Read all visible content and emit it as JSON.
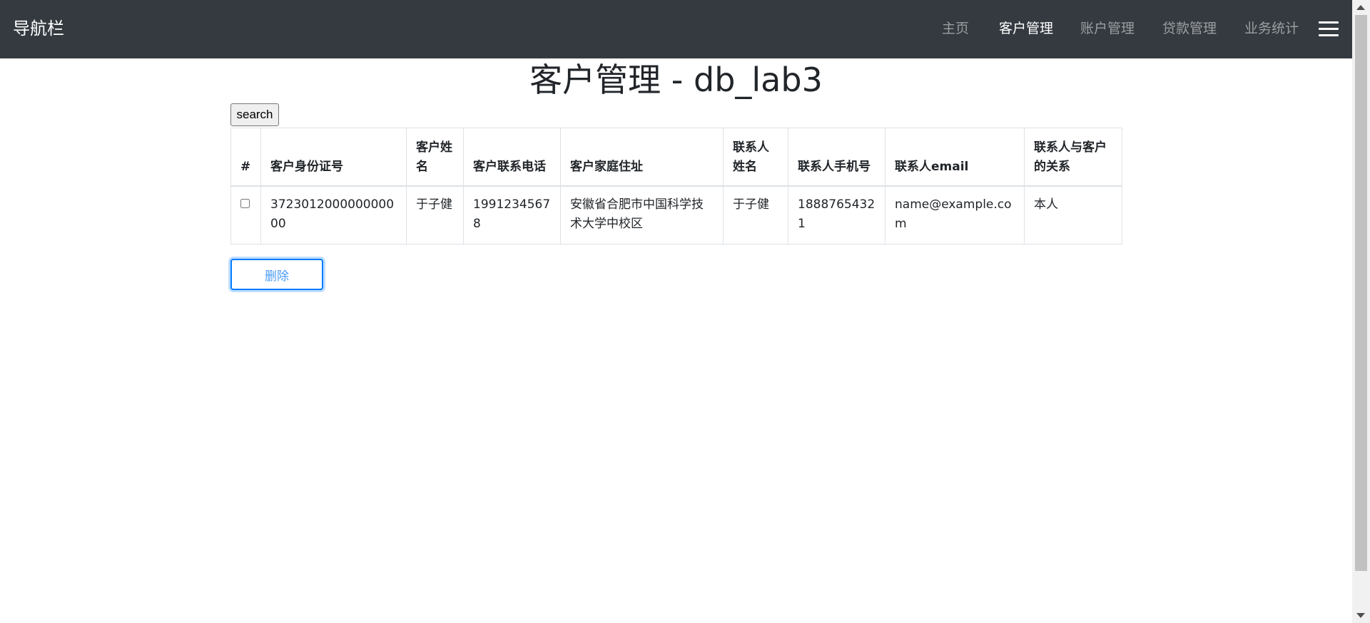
{
  "navbar": {
    "brand": "导航栏",
    "items": [
      {
        "label": "主页",
        "active": false
      },
      {
        "label": "客户管理",
        "active": true
      },
      {
        "label": "账户管理",
        "active": false
      },
      {
        "label": "贷款管理",
        "active": false
      },
      {
        "label": "业务统计",
        "active": false
      }
    ],
    "toggler_icon": "hamburger-menu-icon"
  },
  "main": {
    "title": "客户管理 - db_lab3",
    "search_label": "search",
    "delete_label": "删除"
  },
  "table": {
    "headers": [
      "#",
      "客户身份证号",
      "客户姓名",
      "客户联系电话",
      "客户家庭住址",
      "联系人姓名",
      "联系人手机号",
      "联系人email",
      "联系人与客户的关系"
    ],
    "rows": [
      {
        "checked": false,
        "id_number": "372301200000000000",
        "name": "于子健",
        "phone": "19912345678",
        "address": "安徽省合肥市中国科学技术大学中校区",
        "contact_name": "于子健",
        "contact_phone": "18887654321",
        "contact_email": "name@example.com",
        "relation": "本人"
      }
    ]
  },
  "colors": {
    "navbar_bg": "#343a40",
    "primary": "#007bff",
    "text": "#212529"
  }
}
